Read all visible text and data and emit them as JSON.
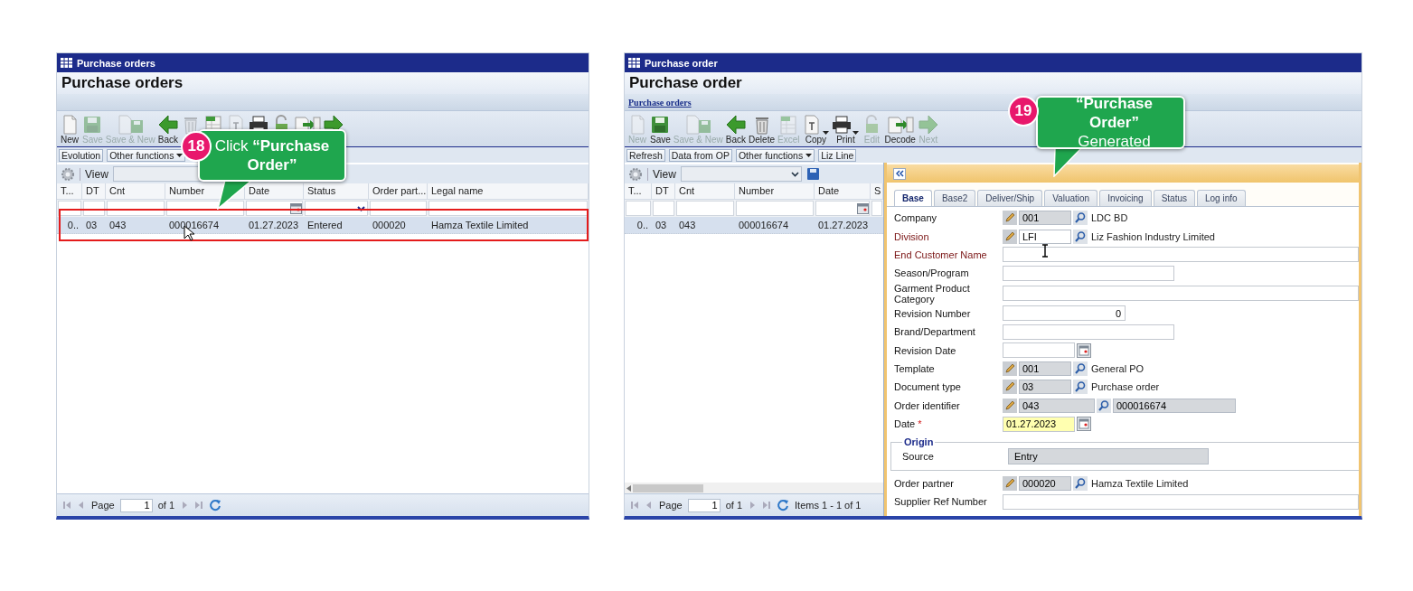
{
  "left_window": {
    "title": "Purchase orders",
    "heading": "Purchase orders",
    "toolbar": [
      {
        "kind": "new",
        "label": "New",
        "disabled": false
      },
      {
        "kind": "save",
        "label": "Save",
        "disabled": true
      },
      {
        "kind": "save_new",
        "label": "Save & New",
        "disabled": true
      },
      {
        "kind": "back",
        "label": "Back",
        "disabled": false
      },
      {
        "kind": "delete",
        "disabled": true
      },
      {
        "kind": "excel",
        "disabled": false
      },
      {
        "kind": "copy",
        "disabled": true
      },
      {
        "kind": "print",
        "disabled": false
      },
      {
        "kind": "edit",
        "disabled": false
      },
      {
        "kind": "decode",
        "disabled": false
      },
      {
        "kind": "next",
        "disabled": false
      }
    ],
    "functions": [
      {
        "label": "Evolution",
        "menu": false
      },
      {
        "label": "Other functions",
        "menu": true
      }
    ],
    "view_label": "View",
    "columns": [
      {
        "label": "T...",
        "kind": "text"
      },
      {
        "label": "DT",
        "kind": "text"
      },
      {
        "label": "Cnt",
        "kind": "text"
      },
      {
        "label": "Number",
        "kind": "text"
      },
      {
        "label": "Date",
        "kind": "date"
      },
      {
        "label": "Status",
        "kind": "select"
      },
      {
        "label": "Order part...",
        "kind": "text"
      },
      {
        "label": "Legal name",
        "kind": "text"
      }
    ],
    "rows": [
      {
        "selected": true,
        "cells": [
          "0..",
          "03",
          "043",
          "000016674",
          "01.27.2023",
          "Entered",
          "000020",
          "Hamza Textile Limited"
        ]
      }
    ],
    "pager": {
      "page_label": "Page",
      "page": "1",
      "of": "of 1"
    },
    "callout": {
      "number": "18",
      "text": "Click **“Purchase Order”**"
    }
  },
  "right_window": {
    "title": "Purchase order",
    "heading": "Purchase order",
    "breadcrumb": "Purchase orders",
    "toolbar": [
      {
        "kind": "new",
        "label": "New",
        "disabled": true
      },
      {
        "kind": "save",
        "label": "Save",
        "disabled": false
      },
      {
        "kind": "save_new",
        "label": "Save & New",
        "disabled": true
      },
      {
        "kind": "back",
        "label": "Back",
        "disabled": false
      },
      {
        "kind": "delete",
        "label": "Delete",
        "disabled": false
      },
      {
        "kind": "excel",
        "label": "Excel",
        "disabled": true
      },
      {
        "kind": "copy",
        "label": "Copy",
        "disabled": false,
        "menu": true
      },
      {
        "kind": "print",
        "label": "Print",
        "disabled": false,
        "menu": true
      },
      {
        "kind": "edit",
        "label": "Edit",
        "disabled": true
      },
      {
        "kind": "decode",
        "label": "Decode",
        "disabled": false
      },
      {
        "kind": "next",
        "label": "Next",
        "disabled": true
      }
    ],
    "functions": [
      {
        "label": "Refresh",
        "menu": false
      },
      {
        "label": "Data from OP",
        "menu": false
      },
      {
        "label": "Other functions",
        "menu": true
      },
      {
        "label": "Liz Line",
        "menu": false
      }
    ],
    "view_label": "View",
    "columns": [
      {
        "label": "T...",
        "kind": "text"
      },
      {
        "label": "DT",
        "kind": "text"
      },
      {
        "label": "Cnt",
        "kind": "text"
      },
      {
        "label": "Number",
        "kind": "text"
      },
      {
        "label": "Date",
        "kind": "date"
      },
      {
        "label": "S",
        "kind": "text"
      }
    ],
    "rows": [
      {
        "selected": true,
        "cells": [
          "0..",
          "03",
          "043",
          "000016674",
          "01.27.2023"
        ]
      }
    ],
    "pager": {
      "page_label": "Page",
      "page": "1",
      "of": "of 1",
      "items": "Items 1 - 1 of 1"
    },
    "tabs": [
      {
        "label": "Base",
        "selected": true
      },
      {
        "label": "Base2",
        "selected": false
      },
      {
        "label": "Deliver/Ship",
        "selected": false
      },
      {
        "label": "Valuation",
        "selected": false
      },
      {
        "label": "Invoicing",
        "selected": false
      },
      {
        "label": "Status",
        "selected": false
      },
      {
        "label": "Log info",
        "selected": false
      }
    ],
    "form": [
      {
        "label": "Company",
        "required": false,
        "kind": "lookup",
        "code": "001",
        "editable": false,
        "description": "LDC BD"
      },
      {
        "label": "Division",
        "required": true,
        "kind": "lookup",
        "code": "LFI",
        "editable": true,
        "description": "Liz Fashion Industry Limited"
      },
      {
        "label": "End Customer Name",
        "required": true,
        "kind": "text_long"
      },
      {
        "label": "Season/Program",
        "required": false,
        "kind": "text_short"
      },
      {
        "label": "Garment Product Category",
        "required": false,
        "kind": "text_long"
      },
      {
        "label": "Revision Number",
        "required": false,
        "kind": "number",
        "value": "0"
      },
      {
        "label": "Brand/Department",
        "required": false,
        "kind": "text_short"
      },
      {
        "label": "Revision Date",
        "required": false,
        "kind": "date",
        "highlighted": false
      },
      {
        "label": "Template",
        "required": false,
        "kind": "lookup",
        "code": "001",
        "editable": false,
        "description": "General PO"
      },
      {
        "label": "Document type",
        "required": false,
        "kind": "lookup",
        "code": "03",
        "editable": false,
        "description": "Purchase order"
      },
      {
        "label": "Order identifier",
        "required": false,
        "kind": "lookup_ref",
        "code": "043",
        "reference": "000016674"
      },
      {
        "label": "Date",
        "required": false,
        "marker": "*",
        "kind": "date",
        "value": "01.27.2023",
        "highlighted": true
      },
      {
        "kind": "group",
        "title": "Origin",
        "fields": [
          {
            "label": "Source",
            "required": false,
            "kind": "readonly",
            "value": "Entry"
          }
        ]
      },
      {
        "label": "Order partner",
        "required": false,
        "kind": "lookup",
        "code": "000020",
        "editable": false,
        "description": "Hamza Textile Limited"
      },
      {
        "label": "Supplier Ref Number",
        "required": false,
        "kind": "text_long"
      }
    ],
    "callout": {
      "number": "19",
      "text": "**“Purchase Order”** Generated"
    }
  }
}
